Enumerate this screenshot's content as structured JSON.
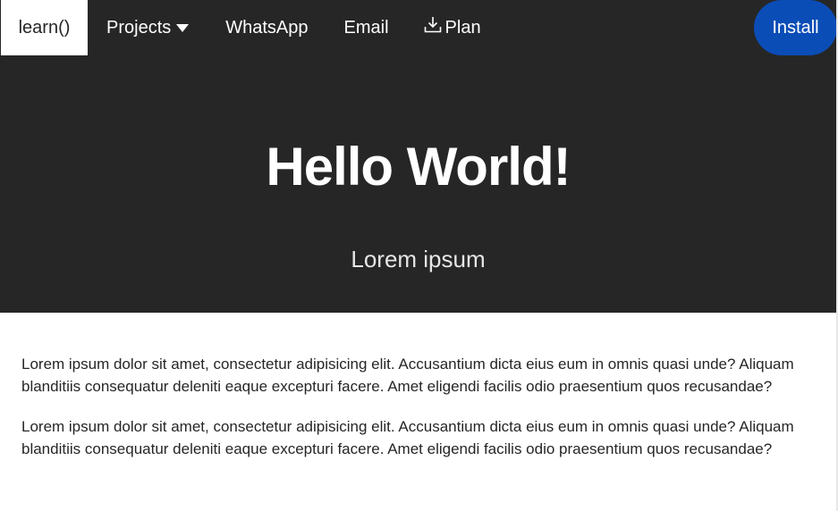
{
  "nav": {
    "brand": "learn()",
    "projects_label": "Projects",
    "whatsapp_label": "WhatsApp",
    "email_label": "Email",
    "plan_label": "Plan",
    "install_label": "Install"
  },
  "hero": {
    "title": "Hello World!",
    "subtitle": "Lorem ipsum"
  },
  "content": {
    "paragraphs": [
      "Lorem ipsum dolor sit amet, consectetur adipisicing elit. Accusantium dicta eius eum in omnis quasi unde? Aliquam blanditiis consequatur deleniti eaque excepturi facere. Amet eligendi facilis odio praesentium quos recusandae?",
      "Lorem ipsum dolor sit amet, consectetur adipisicing elit. Accusantium dicta eius eum in omnis quasi unde? Aliquam blanditiis consequatur deleniti eaque excepturi facere. Amet eligendi facilis odio praesentium quos recusandae?"
    ]
  },
  "icons": {
    "projects_caret": "caret-down-icon",
    "plan_icon": "download-icon"
  },
  "colors": {
    "dark_bg": "#262626",
    "accent": "#0b4db6",
    "text": "#262626",
    "white": "#ffffff"
  }
}
